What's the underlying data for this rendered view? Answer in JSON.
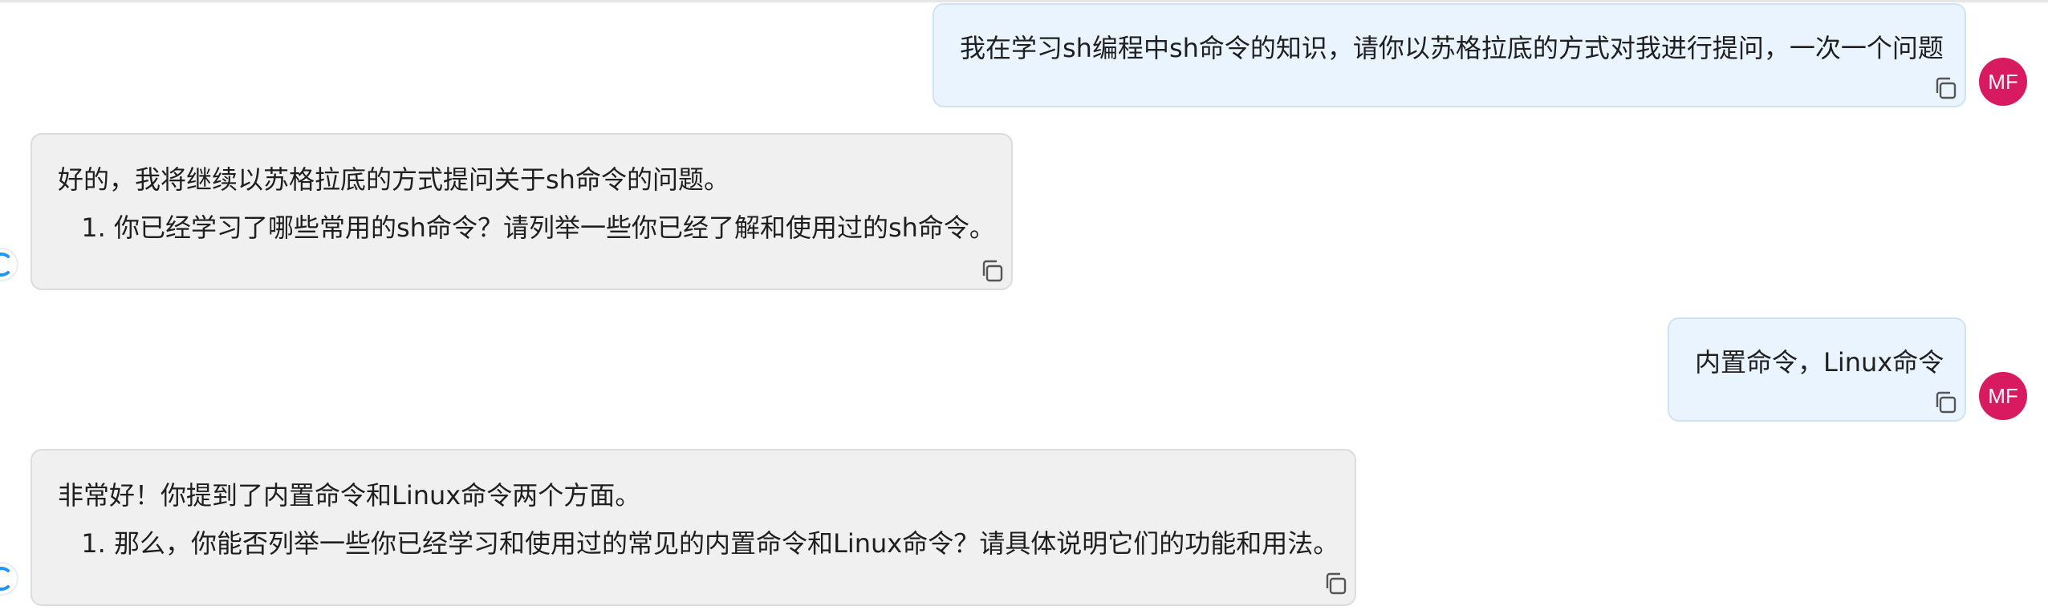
{
  "colors": {
    "user_bubble_bg": "#e9f4ff",
    "bot_bubble_bg": "#f0f0f0",
    "avatar_bg": "#d81b60",
    "accent": "#2196f3"
  },
  "messages": [
    {
      "role": "user",
      "avatar_initials": "MF",
      "text": "我在学习sh编程中sh命令的知识，请你以苏格拉底的方式对我进行提问，一次一个问题",
      "copy_icon": "copy-icon"
    },
    {
      "role": "assistant",
      "bot_icon": "bot-icon",
      "intro": "好的，我将继续以苏格拉底的方式提问关于sh命令的问题。",
      "items": [
        "你已经学习了哪些常用的sh命令？请列举一些你已经了解和使用过的sh命令。"
      ],
      "copy_icon": "copy-icon"
    },
    {
      "role": "user",
      "avatar_initials": "MF",
      "text": "内置命令，Linux命令",
      "copy_icon": "copy-icon"
    },
    {
      "role": "assistant",
      "bot_icon": "bot-icon",
      "intro": "非常好！你提到了内置命令和Linux命令两个方面。",
      "items": [
        "那么，你能否列举一些你已经学习和使用过的常见的内置命令和Linux命令？请具体说明它们的功能和用法。"
      ],
      "copy_icon": "copy-icon"
    }
  ]
}
